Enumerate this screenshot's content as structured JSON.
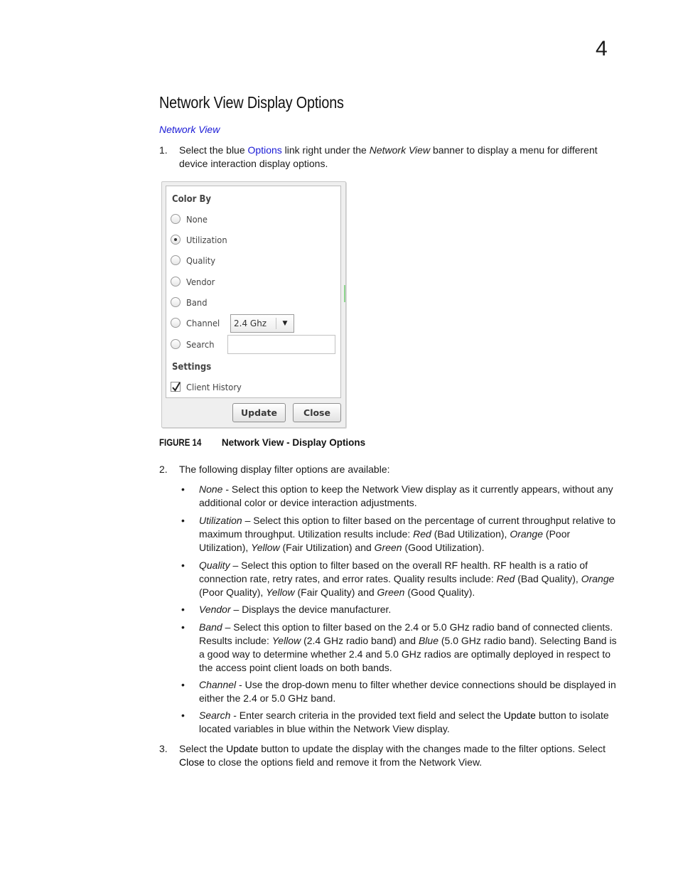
{
  "chapter_number": "4",
  "section_title": "Network View Display Options",
  "nav_link": "Network View",
  "steps": [
    {
      "number": "1.",
      "parts": {
        "a": "Select the blue ",
        "link": "Options",
        "b": " link right under the ",
        "em": "Network View",
        "c": " banner to display a menu for different device interaction display options."
      }
    },
    {
      "number": "2.",
      "text": "The following display filter options are available:"
    },
    {
      "number": "3.",
      "parts": {
        "a": "Select the ",
        "bold1": "Update",
        "b": " button to update the display with the changes made to the filter options. Select ",
        "bold2": "Close",
        "c": " to close the options field and remove it from the Network View."
      }
    }
  ],
  "figure": {
    "color_by_title": "Color By",
    "options": [
      {
        "label": "None",
        "selected": false
      },
      {
        "label": "Utilization",
        "selected": true
      },
      {
        "label": "Quality",
        "selected": false
      },
      {
        "label": "Vendor",
        "selected": false
      },
      {
        "label": "Band",
        "selected": false
      },
      {
        "label": "Channel",
        "selected": false
      },
      {
        "label": "Search",
        "selected": false
      }
    ],
    "channel_dropdown": {
      "value": "2.4 Ghz",
      "icon": "triangle-down-icon"
    },
    "search_input": {
      "value": "",
      "placeholder": ""
    },
    "settings_title": "Settings",
    "client_history": {
      "label": "Client History",
      "checked": true
    },
    "update_button": "Update",
    "close_button": "Close"
  },
  "caption": {
    "label": "FIGURE 14",
    "title": "Network View - Display Options"
  },
  "bullets": [
    {
      "term": "None",
      "text": " - Select this option to keep the Network View display as it currently appears, without any additional color or device interaction adjustments."
    },
    {
      "term": "Utilization",
      "segments": [
        {
          "t": " – Select this option to filter based on the percentage of current throughput relative to maximum throughput. Utilization results include: "
        },
        {
          "t": "Red",
          "i": true
        },
        {
          "t": " (Bad Utilization), "
        },
        {
          "t": "Orange",
          "i": true
        },
        {
          "t": " (Poor Utilization), "
        },
        {
          "t": "Yellow",
          "i": true
        },
        {
          "t": " (Fair Utilization) and "
        },
        {
          "t": "Green",
          "i": true
        },
        {
          "t": " (Good Utilization)."
        }
      ]
    },
    {
      "term": "Quality",
      "segments": [
        {
          "t": " – Select this option to filter based on the overall RF health. RF health is a ratio of connection rate, retry rates, and error rates. Quality results include: "
        },
        {
          "t": "Red",
          "i": true
        },
        {
          "t": " (Bad Quality), "
        },
        {
          "t": "Orange",
          "i": true
        },
        {
          "t": " (Poor Quality), "
        },
        {
          "t": "Yellow",
          "i": true
        },
        {
          "t": " (Fair Quality) and "
        },
        {
          "t": "Green",
          "i": true
        },
        {
          "t": " (Good Quality)."
        }
      ]
    },
    {
      "term": "Vendor",
      "text": " – Displays the device manufacturer."
    },
    {
      "term": "Band",
      "segments": [
        {
          "t": " – Select this option to filter based on the 2.4 or 5.0 GHz radio band of connected clients. Results include: "
        },
        {
          "t": "Yellow",
          "i": true
        },
        {
          "t": " (2.4 GHz radio band) and "
        },
        {
          "t": "Blue",
          "i": true
        },
        {
          "t": " (5.0 GHz radio band). Selecting Band is a good way to determine whether 2.4 and 5.0 GHz radios are optimally deployed in respect to the access point client loads on both bands."
        }
      ]
    },
    {
      "term": "Channel",
      "text": " - Use the drop-down menu to filter whether device connections should be displayed in either the 2.4 or 5.0 GHz band."
    },
    {
      "term": "Search",
      "segments": [
        {
          "t": " - Enter search criteria in the provided text field and select the "
        },
        {
          "t": "Update",
          "b": true
        },
        {
          "t": " button to isolate located variables in blue within the Network View display."
        }
      ]
    }
  ],
  "colors": {
    "link": "#1a1ad6",
    "text": "#1a1a1a"
  }
}
